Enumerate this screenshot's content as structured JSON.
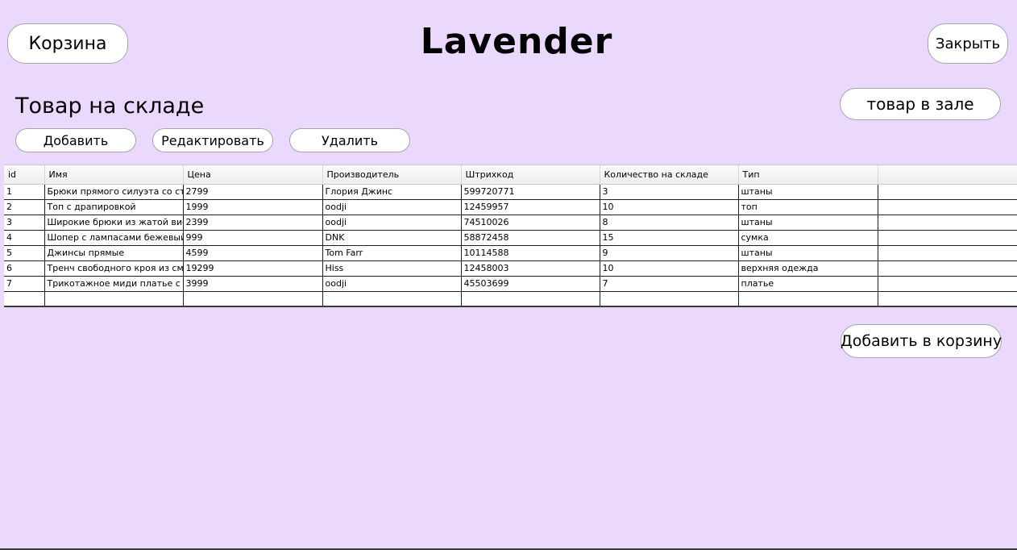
{
  "header": {
    "cart_label": "Корзина",
    "logo": "Lavender",
    "close_label": "Закрыть"
  },
  "warehouse": {
    "title": "Товар на складе",
    "hall_button": "товар в зале",
    "add_label": "Добавить",
    "edit_label": "Редактировать",
    "delete_label": "Удалить"
  },
  "table": {
    "columns": [
      "id",
      "Имя",
      "Цена",
      "Производитель",
      "Штрихкод",
      "Количество на складе",
      "Тип",
      ""
    ],
    "rows": [
      [
        "1",
        "Брюки прямого силуэта со стрелками",
        "2799",
        "Глория Джинс",
        "599720771",
        "3",
        "штаны",
        ""
      ],
      [
        "2",
        "Топ с драпировкой",
        "1999",
        "oodji",
        "12459957",
        "10",
        "топ",
        ""
      ],
      [
        "3",
        "Широкие брюки из жатой вискозы",
        "2399",
        "oodji",
        "74510026",
        "8",
        "штаны",
        ""
      ],
      [
        "4",
        "Шопер с лампасами бежевый",
        "999",
        "DNK",
        "58872458",
        "15",
        "сумка",
        ""
      ],
      [
        "5",
        "Джинсы прямые",
        "4599",
        "Tom Farr",
        "10114588",
        "9",
        "штаны",
        ""
      ],
      [
        "6",
        "Тренч свободного кроя из смесового хлопка",
        "19299",
        "Hiss",
        "12458003",
        "10",
        "верхняя одежда",
        ""
      ],
      [
        "7",
        "Трикотажное миди платье с длинным рукавом",
        "3999",
        "oodji",
        "45503699",
        "7",
        "платье",
        ""
      ],
      [
        "",
        "",
        "",
        "",
        "",
        "",
        "",
        ""
      ]
    ]
  },
  "footer": {
    "add_to_cart_label": "Добавить в корзину"
  }
}
